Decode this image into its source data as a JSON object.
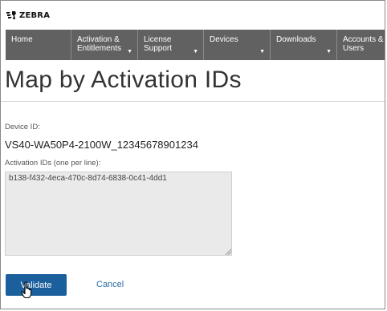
{
  "brand": {
    "name": "ZEBRA",
    "icon": "zebra-logo"
  },
  "nav": {
    "items": [
      {
        "line1": "Home",
        "line2": "",
        "has_caret": false
      },
      {
        "line1": "Activation &",
        "line2": "Entitlements",
        "has_caret": true
      },
      {
        "line1": "License",
        "line2": "Support",
        "has_caret": true
      },
      {
        "line1": "Devices",
        "line2": "",
        "has_caret": true
      },
      {
        "line1": "Downloads",
        "line2": "",
        "has_caret": true
      },
      {
        "line1": "Accounts &",
        "line2": "Users",
        "has_caret": false
      }
    ],
    "caret_icon": "chevron-down-icon",
    "background": "#616161"
  },
  "page": {
    "title": "Map by Activation IDs"
  },
  "form": {
    "device_id_label": "Device ID:",
    "device_id_value": "VS40-WA50P4-2100W_12345678901234",
    "activation_ids_label": "Activation IDs (one per line):",
    "activation_ids_value": "b138-f432-4eca-470c-8d74-6838-0c41-4dd1"
  },
  "actions": {
    "validate_label": "Validate",
    "cancel_label": "Cancel",
    "primary_color": "#1c5f9d",
    "link_color": "#2d6ea8"
  },
  "cursor": {
    "type": "hand-pointer-icon"
  }
}
